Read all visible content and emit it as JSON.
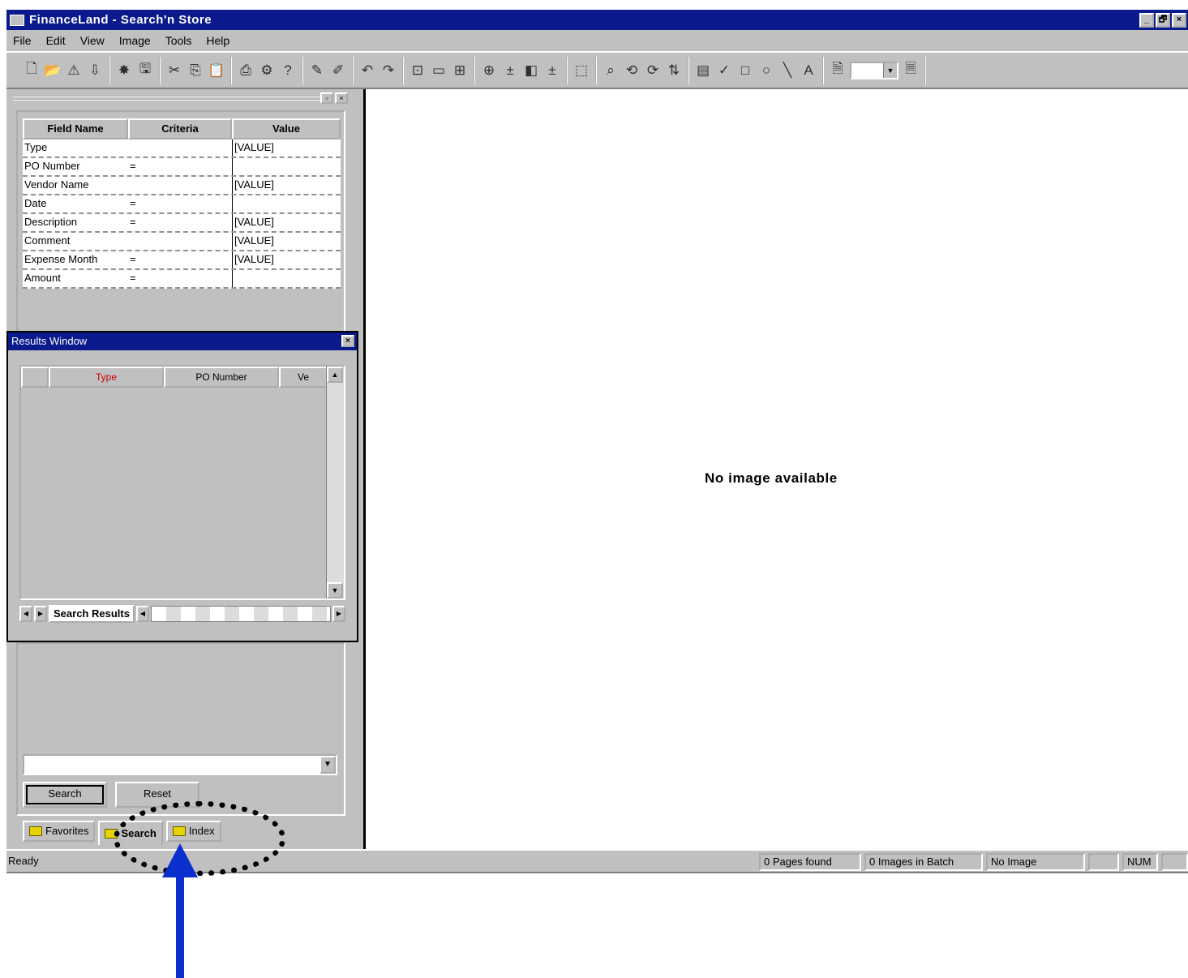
{
  "window": {
    "title": "FinanceLand - Search'n Store",
    "buttons": [
      "_",
      "🗗",
      "×"
    ]
  },
  "menu": [
    "File",
    "Edit",
    "View",
    "Image",
    "Tools",
    "Help"
  ],
  "toolbar_icons": [
    [
      "new-icon",
      "open-icon",
      "scan-icon",
      "import-icon"
    ],
    [
      "batch-icon",
      "save-icon"
    ],
    [
      "cut-icon",
      "copy-icon",
      "paste-icon"
    ],
    [
      "print-icon",
      "properties-icon",
      "help-icon"
    ],
    [
      "pen-icon",
      "pen2-icon"
    ],
    [
      "undo-icon",
      "redo-icon"
    ],
    [
      "fit-icon",
      "page-icon",
      "crop-icon"
    ],
    [
      "zoom-in-icon",
      "plus-icon",
      "contrast-icon",
      "plus2-icon"
    ],
    [
      "select-icon"
    ],
    [
      "zoom-icon",
      "rotate-icon",
      "rotate2-icon",
      "flip-icon"
    ],
    [
      "highlight-icon",
      "mark-icon",
      "rect-icon",
      "ellipse-icon",
      "line-icon",
      "text-icon"
    ],
    [
      "doc-icon",
      "doc2-icon"
    ]
  ],
  "query_grid": {
    "headers": [
      "Field Name",
      "Criteria",
      "Value"
    ],
    "rows": [
      {
        "field": "Type",
        "criteria": "",
        "value": "[VALUE]"
      },
      {
        "field": "PO Number",
        "criteria": "=",
        "value": ""
      },
      {
        "field": "Vendor Name",
        "criteria": "",
        "value": "[VALUE]"
      },
      {
        "field": "Date",
        "criteria": "=",
        "value": ""
      },
      {
        "field": "Description",
        "criteria": "=",
        "value": "[VALUE]"
      },
      {
        "field": "Comment",
        "criteria": "",
        "value": "[VALUE]"
      },
      {
        "field": "Expense Month",
        "criteria": "=",
        "value": "[VALUE]"
      },
      {
        "field": "Amount",
        "criteria": "=",
        "value": ""
      }
    ]
  },
  "results_window": {
    "title": "Results Window",
    "headers": [
      "",
      "Type",
      "PO Number",
      "Ve"
    ],
    "tab_label": "Search Results"
  },
  "search_panel": {
    "query_value": "",
    "search_label": "Search",
    "reset_label": "Reset"
  },
  "bottom_tabs": [
    "Favorites",
    "Search",
    "Index"
  ],
  "main": {
    "placeholder": "No image available"
  },
  "status": {
    "ready": "Ready",
    "cells": [
      "0 Pages found",
      "0 Images in Batch",
      "No Image",
      "",
      "NUM",
      ""
    ]
  },
  "colors": {
    "title_bar": "#0a1a8c",
    "chrome": "#c0c0c0",
    "annotation_arrow": "#0b2ecf"
  }
}
